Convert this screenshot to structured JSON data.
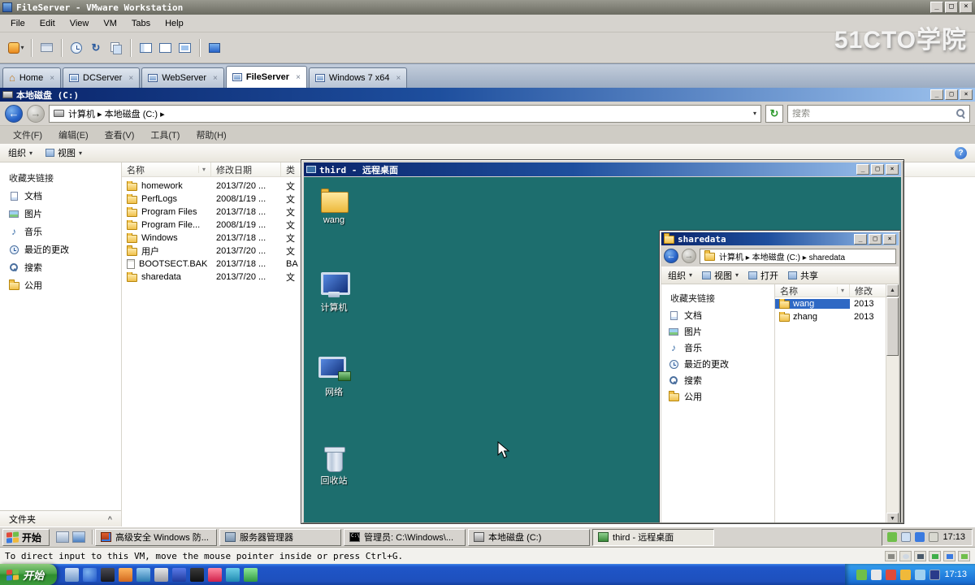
{
  "watermark": "51CTO学院",
  "icons": {
    "minimize": "_",
    "maximize": "□",
    "close": "×",
    "chevron_down": "▾",
    "chevron_up": "^",
    "back_arrow": "←",
    "forward_arrow": "→",
    "refresh": "↻",
    "help": "?",
    "music_note": "♪",
    "home": "⌂",
    "scroll_up": "▲",
    "scroll_down": "▼"
  },
  "vmware": {
    "title": "FileServer - VMware Workstation",
    "menus": [
      "File",
      "Edit",
      "View",
      "VM",
      "Tabs",
      "Help"
    ],
    "tabs": [
      {
        "label": "Home",
        "active": false
      },
      {
        "label": "DCServer",
        "active": false
      },
      {
        "label": "WebServer",
        "active": false
      },
      {
        "label": "FileServer",
        "active": true
      },
      {
        "label": "Windows 7 x64",
        "active": false
      }
    ],
    "status_text": "To direct input to this VM, move the mouse pointer inside or press Ctrl+G."
  },
  "explorer1": {
    "title": "本地磁盘 (C:)",
    "address": "计算机 ▸ 本地磁盘 (C:) ▸",
    "search_placeholder": "搜索",
    "menus": [
      "文件(F)",
      "编辑(E)",
      "查看(V)",
      "工具(T)",
      "帮助(H)"
    ],
    "organize": "组织",
    "views": "视图",
    "favorites_header": "收藏夹链接",
    "favorites": [
      "文档",
      "图片",
      "音乐",
      "最近的更改",
      "搜索",
      "公用"
    ],
    "folders_label": "文件夹",
    "columns": {
      "name": "名称",
      "date": "修改日期",
      "type": "类"
    },
    "files": [
      {
        "name": "homework",
        "date": "2013/7/20 ...",
        "type": "文"
      },
      {
        "name": "PerfLogs",
        "date": "2008/1/19 ...",
        "type": "文"
      },
      {
        "name": "Program Files",
        "date": "2013/7/18 ...",
        "type": "文"
      },
      {
        "name": "Program File...",
        "date": "2008/1/19 ...",
        "type": "文"
      },
      {
        "name": "Windows",
        "date": "2013/7/18 ...",
        "type": "文"
      },
      {
        "name": "用户",
        "date": "2013/7/20 ...",
        "type": "文"
      },
      {
        "name": "BOOTSECT.BAK",
        "date": "2013/7/18 ...",
        "type": "BA"
      },
      {
        "name": "sharedata",
        "date": "2013/7/20 ...",
        "type": "文"
      }
    ]
  },
  "remote": {
    "title": "third - 远程桌面",
    "icons": [
      {
        "label": "wang"
      },
      {
        "label": "计算机"
      },
      {
        "label": "网络"
      },
      {
        "label": "回收站"
      }
    ]
  },
  "explorer2": {
    "title": "sharedata",
    "address": "计算机 ▸ 本地磁盘 (C:) ▸ sharedata",
    "organize": "组织",
    "views": "视图",
    "open_label": "打开",
    "share_label": "共享",
    "favorites_header": "收藏夹链接",
    "favorites": [
      "文档",
      "图片",
      "音乐",
      "最近的更改",
      "搜索",
      "公用"
    ],
    "columns": {
      "name": "名称",
      "date": "修改"
    },
    "files": [
      {
        "name": "wang",
        "date": "2013",
        "selected": true
      },
      {
        "name": "zhang",
        "date": "2013",
        "selected": false
      }
    ]
  },
  "vm_taskbar": {
    "start_label": "开始",
    "tasks": [
      {
        "label": "高级安全 Windows 防..."
      },
      {
        "label": "服务器管理器"
      },
      {
        "label": "管理员: C:\\Windows\\..."
      },
      {
        "label": "本地磁盘 (C:)"
      },
      {
        "label": "third - 远程桌面"
      }
    ],
    "time": "17:13"
  },
  "host_taskbar": {
    "start_label": "开始",
    "time": "17:13"
  }
}
